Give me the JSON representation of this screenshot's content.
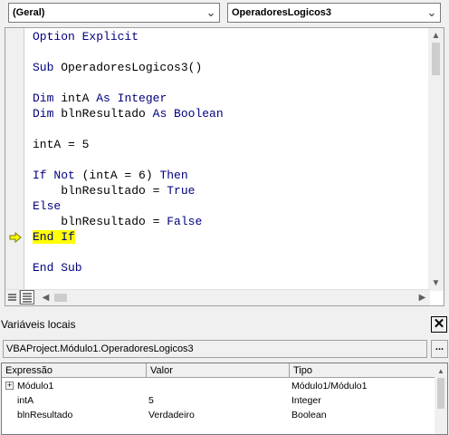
{
  "toolbar": {
    "object_combo": "(Geral)",
    "procedure_combo": "OperadoresLogicos3"
  },
  "code": {
    "lines": [
      [
        {
          "t": "Option Explicit",
          "k": true
        }
      ],
      [],
      [
        {
          "t": "Sub ",
          "k": true
        },
        {
          "t": "OperadoresLogicos3()",
          "k": false
        }
      ],
      [],
      [
        {
          "t": "Dim ",
          "k": true
        },
        {
          "t": "intA ",
          "k": false
        },
        {
          "t": "As Integer",
          "k": true
        }
      ],
      [
        {
          "t": "Dim ",
          "k": true
        },
        {
          "t": "blnResultado ",
          "k": false
        },
        {
          "t": "As Boolean",
          "k": true
        }
      ],
      [],
      [
        {
          "t": "intA = 5",
          "k": false
        }
      ],
      [],
      [
        {
          "t": "If Not ",
          "k": true
        },
        {
          "t": "(intA = 6) ",
          "k": false
        },
        {
          "t": "Then",
          "k": true
        }
      ],
      [
        {
          "t": "    blnResultado = ",
          "k": false
        },
        {
          "t": "True",
          "k": true
        }
      ],
      [
        {
          "t": "Else",
          "k": true
        }
      ],
      [
        {
          "t": "    blnResultado = ",
          "k": false
        },
        {
          "t": "False",
          "k": true
        }
      ],
      [
        {
          "t": "End If",
          "k": true,
          "hl": true
        }
      ],
      [],
      [
        {
          "t": "End Sub",
          "k": true
        }
      ]
    ],
    "execution_line": 13
  },
  "locals": {
    "title": "Variáveis locais",
    "close": "✕",
    "context": "VBAProject.Módulo1.OperadoresLogicos3",
    "context_button": "...",
    "headers": {
      "expr": "Expressão",
      "value": "Valor",
      "type": "Tipo"
    },
    "rows": [
      {
        "expr": "Módulo1",
        "value": "",
        "type": "Módulo1/Módulo1",
        "expandable": true
      },
      {
        "expr": "intA",
        "value": "5",
        "type": "Integer",
        "expandable": false
      },
      {
        "expr": "blnResultado",
        "value": "Verdadeiro",
        "type": "Boolean",
        "expandable": false
      }
    ]
  }
}
